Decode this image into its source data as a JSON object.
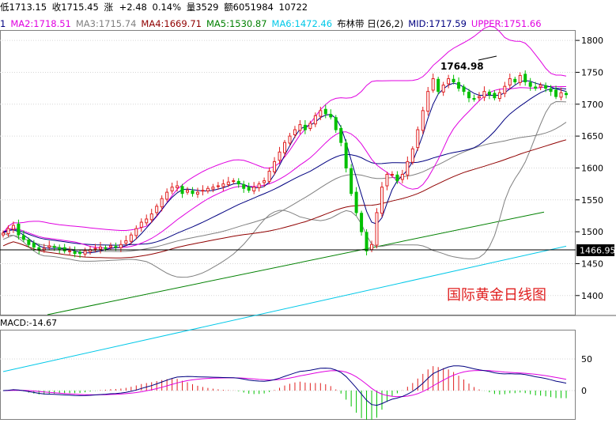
{
  "quote_bar": {
    "low_label": "低",
    "low": "1713.15",
    "close_label": "收",
    "close": "1715.45",
    "change_label": "涨",
    "change": "+2.48",
    "change_pct": "0.14%",
    "volume_label": "量",
    "volume": "3529",
    "amount_label": "额",
    "amount": "6051984",
    "open_interest": "10722"
  },
  "indicator_bar": [
    {
      "text": "1",
      "color": "#000080"
    },
    {
      "text": "MA2:1718.51",
      "color": "#e000e0"
    },
    {
      "text": "MA3:1715.74",
      "color": "#808080"
    },
    {
      "text": "MA4:1669.71",
      "color": "#900000"
    },
    {
      "text": "MA5:1530.87",
      "color": "#008000"
    },
    {
      "text": "MA6:1472.46",
      "color": "#00c8e8"
    },
    {
      "text": "布林带 日(26,2)",
      "color": "#000000"
    },
    {
      "text": "MID:1717.59",
      "color": "#000080"
    },
    {
      "text": "UPPER:1751.66",
      "color": "#e000e0"
    }
  ],
  "macd_label": "MACD:-14.67",
  "watermark": "国际黄金日线图",
  "peak_annotation": "1764.98",
  "last_price_tag": "1466.95",
  "colors": {
    "up": "#e02020",
    "down": "#00c000",
    "ma1": "#000080",
    "ma2": "#e000e0",
    "ma3": "#808080",
    "ma4": "#900000",
    "ma5": "#008000",
    "ma6": "#00c8e8",
    "grid": "#c8c8c8",
    "text": "#000000",
    "watermark": "#e02020"
  },
  "chart_data": {
    "type": "candlestick",
    "price_axis": {
      "ticks": [
        "1800",
        "1750",
        "1700",
        "1650",
        "1600",
        "1550",
        "1500",
        "1450",
        "1400"
      ],
      "ylim": [
        1370,
        1815
      ]
    },
    "macd_axis": {
      "ticks": [
        "50",
        "0"
      ],
      "ylim": [
        -45,
        95
      ]
    },
    "close": [
      1498,
      1505,
      1510,
      1495,
      1488,
      1480,
      1476,
      1472,
      1474,
      1478,
      1476,
      1473,
      1470,
      1470,
      1466,
      1466,
      1470,
      1472,
      1474,
      1476,
      1474,
      1478,
      1476,
      1480,
      1486,
      1495,
      1505,
      1515,
      1520,
      1528,
      1540,
      1552,
      1562,
      1570,
      1572,
      1560,
      1565,
      1560,
      1562,
      1565,
      1568,
      1570,
      1572,
      1575,
      1578,
      1580,
      1575,
      1568,
      1565,
      1570,
      1575,
      1580,
      1595,
      1610,
      1625,
      1640,
      1650,
      1660,
      1668,
      1660,
      1670,
      1682,
      1690,
      1685,
      1680,
      1660,
      1640,
      1600,
      1560,
      1530,
      1500,
      1470,
      1480,
      1530,
      1570,
      1590,
      1590,
      1580,
      1590,
      1610,
      1630,
      1660,
      1690,
      1720,
      1740,
      1720,
      1730,
      1740,
      1735,
      1725,
      1720,
      1710,
      1708,
      1712,
      1720,
      1715,
      1710,
      1718,
      1728,
      1740,
      1735,
      1745,
      1735,
      1728,
      1725,
      1730,
      1725,
      1720,
      1712,
      1718,
      1715
    ],
    "ma1": [
      1500,
      1502,
      1503,
      1500,
      1495,
      1489,
      1483,
      1478,
      1475,
      1474,
      1474,
      1474,
      1473,
      1472,
      1470,
      1468,
      1467,
      1467,
      1468,
      1470,
      1472,
      1474,
      1475,
      1476,
      1478,
      1482,
      1489,
      1497,
      1506,
      1515,
      1525,
      1535,
      1545,
      1554,
      1561,
      1566,
      1567,
      1566,
      1565,
      1564,
      1564,
      1565,
      1567,
      1569,
      1572,
      1575,
      1576,
      1574,
      1571,
      1569,
      1569,
      1571,
      1578,
      1590,
      1604,
      1620,
      1635,
      1649,
      1661,
      1665,
      1667,
      1672,
      1679,
      1683,
      1684,
      1678,
      1664,
      1640,
      1612,
      1585,
      1558,
      1532,
      1515,
      1512,
      1522,
      1545,
      1566,
      1580,
      1588,
      1597,
      1610,
      1630,
      1652,
      1678,
      1700,
      1716,
      1724,
      1730,
      1733,
      1731,
      1727,
      1722,
      1717,
      1714,
      1714,
      1714,
      1714,
      1714,
      1718,
      1724,
      1730,
      1735,
      1737,
      1736,
      1733,
      1731,
      1729,
      1727,
      1724,
      1722,
      1720
    ],
    "ma4_last": 1669.71,
    "ma5_last": 1530.87,
    "ma6_last": 1472.46,
    "bollinger": {
      "period": 26,
      "k": 2,
      "mid_last": 1717.59,
      "upper_last": 1751.66
    },
    "macd_last": -14.67
  }
}
